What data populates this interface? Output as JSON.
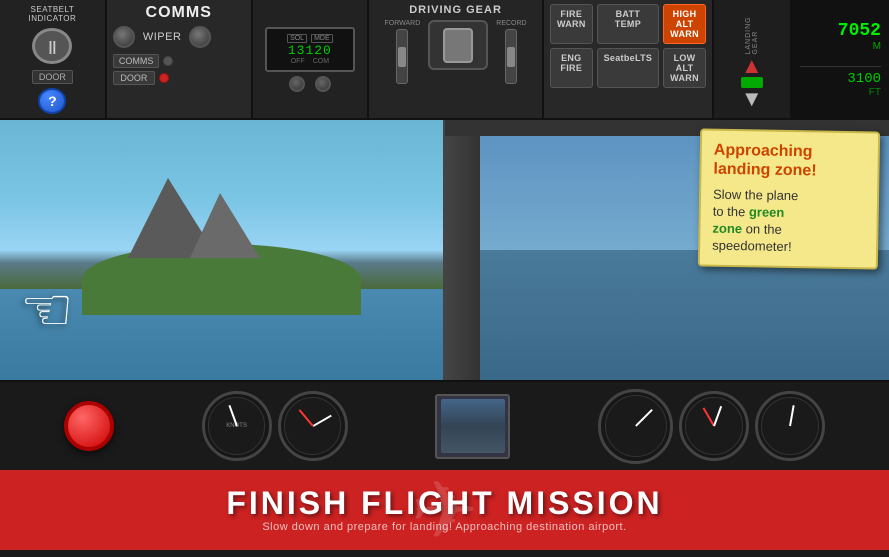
{
  "panel": {
    "seatbelt": {
      "label": "SEATBELT\nINDICATOR",
      "door": "DOOR"
    },
    "comms": {
      "title": "COMMS",
      "wiper": "WIPER",
      "comms_btn": "COMMS",
      "door_btn": "DOOR"
    },
    "display": {
      "sol": "SOL",
      "mde": "MDE",
      "number": "13120",
      "sub1": "OFF",
      "sub2": "COM"
    },
    "gear": {
      "title": "DRIVING GEAR",
      "labels": [
        "FORWARD",
        "RECORD"
      ]
    },
    "landing": {
      "title": "LANDING GEAR"
    },
    "altitude": {
      "value1": "7052",
      "unit1": "M",
      "value2": "3100",
      "unit2": "FT"
    },
    "warn_buttons": [
      {
        "label": "FIRE WARN",
        "active": false
      },
      {
        "label": "BATT TEMP",
        "active": false
      },
      {
        "label": "HIGH ALT WARN",
        "active": true
      },
      {
        "label": "ENG FIRE",
        "active": false
      },
      {
        "label": "SeatbeLTS",
        "active": false
      },
      {
        "label": "LOW ALT WARN",
        "active": false
      }
    ]
  },
  "note": {
    "heading": "Approaching\nlanding zone!",
    "body1": "Slow the plane\nto the ",
    "body_green": "green\nzone",
    "body2": " on the\nspeedometer!"
  },
  "bottom": {
    "title": "FINISH FLIGHT MISSION",
    "subtitle": "Slow down and prepare for landing! Approaching destination airport."
  }
}
